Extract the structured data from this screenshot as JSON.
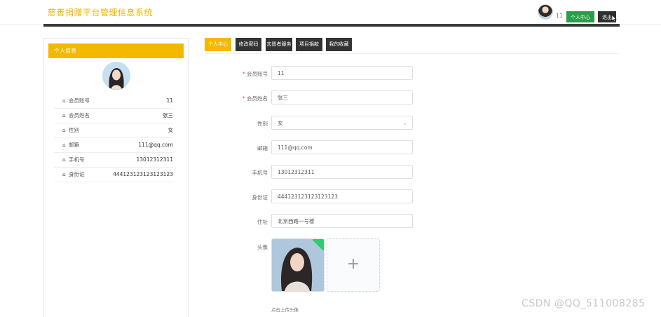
{
  "header": {
    "title": "慈善捐赠平台管理信息系统",
    "username": "11",
    "profile_button": "个人中心",
    "logout_button": "退出"
  },
  "sidebar_card": {
    "heading": "个人信息",
    "rows": [
      {
        "label": "会员账号",
        "value": "11"
      },
      {
        "label": "会员姓名",
        "value": "张三"
      },
      {
        "label": "性别",
        "value": "女"
      },
      {
        "label": "邮箱",
        "value": "111@qq.com"
      },
      {
        "label": "手机号",
        "value": "13012312311"
      },
      {
        "label": "身份证",
        "value": "444123123123123123"
      }
    ]
  },
  "tabs": [
    {
      "label": "个人中心",
      "active": true
    },
    {
      "label": "修改密码",
      "active": false
    },
    {
      "label": "志愿者服务",
      "active": false
    },
    {
      "label": "项目捐款",
      "active": false
    },
    {
      "label": "我的收藏",
      "active": false
    }
  ],
  "form": {
    "fields": [
      {
        "label": "会员账号",
        "required": true,
        "value": "11"
      },
      {
        "label": "会员姓名",
        "required": true,
        "value": "张三"
      },
      {
        "label": "性别",
        "required": false,
        "value": "女"
      },
      {
        "label": "邮箱",
        "required": false,
        "value": "111@qq.com"
      },
      {
        "label": "手机号",
        "required": false,
        "value": "13012312311"
      },
      {
        "label": "身份证",
        "required": false,
        "value": "444123123123123123"
      },
      {
        "label": "住址",
        "required": false,
        "value": "北京西路一号楼"
      }
    ],
    "avatar_label": "头像",
    "add_symbol": "+",
    "hint": "点击上传头像"
  },
  "watermark": "CSDN @QQ_511008285",
  "colors": {
    "accent": "#f5b800",
    "green": "#2a9d4b",
    "dark": "#333333"
  }
}
